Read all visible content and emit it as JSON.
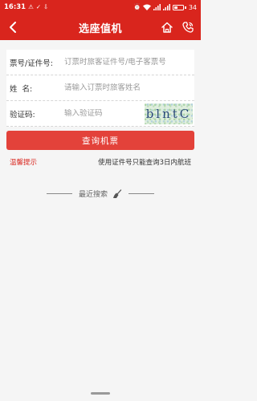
{
  "status_bar": {
    "time": "16:31",
    "battery_text": "34",
    "battery_level": 0.34,
    "icons": [
      "notification-icon",
      "check-icon",
      "download-icon",
      "alarm-icon",
      "wifi-icon",
      "signal-icon",
      "signal-icon",
      "battery-icon"
    ]
  },
  "header": {
    "title": "选座值机",
    "back_icon": "chevron-left-icon",
    "home_icon": "home-icon",
    "phone_icon": "phone-icon",
    "color": "#d9251d"
  },
  "form": {
    "ticket": {
      "label": "票号/证件号:",
      "placeholder": "订票时旅客证件号/电子客票号",
      "value": ""
    },
    "name": {
      "label": "姓  名:",
      "placeholder": "请输入订票时旅客姓名",
      "value": ""
    },
    "captcha": {
      "label": "验证码:",
      "placeholder": "输入验证码",
      "value": "",
      "image_text": "blntC"
    }
  },
  "query_button": {
    "label": "查询机票",
    "color": "#e3423a"
  },
  "tips": {
    "label": "温馨提示",
    "text": "使用证件号只能查询3日内航班"
  },
  "recent_search": {
    "label": "最近搜索",
    "icon": "broom-icon"
  }
}
